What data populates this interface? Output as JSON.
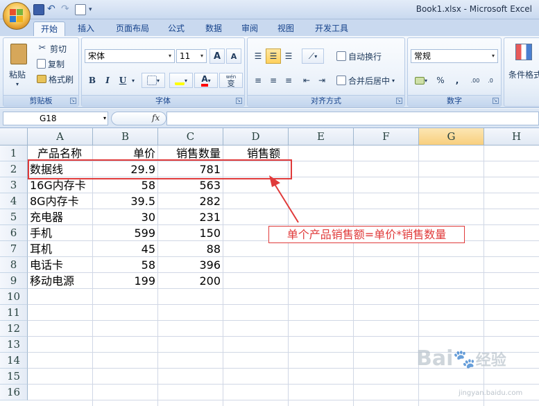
{
  "window": {
    "title": "Book1.xlsx - Microsoft Excel"
  },
  "tabs": [
    "开始",
    "插入",
    "页面布局",
    "公式",
    "数据",
    "审阅",
    "视图",
    "开发工具"
  ],
  "active_tab": "开始",
  "ribbon": {
    "clipboard": {
      "label": "剪贴板",
      "paste": "粘贴",
      "cut": "剪切",
      "copy": "复制",
      "format_painter": "格式刷"
    },
    "font": {
      "label": "字体",
      "font_name": "宋体",
      "font_size": "11",
      "bold": "B",
      "italic": "I",
      "underline": "U",
      "grow": "A",
      "shrink": "A",
      "font_color": "A",
      "wen": "wén",
      "wen_char": "变"
    },
    "alignment": {
      "label": "对齐方式",
      "wrap": "自动换行",
      "merge": "合并后居中"
    },
    "number": {
      "label": "数字",
      "format": "常规",
      "percent": "%",
      "comma": ",",
      "inc": ".00",
      "dec": ".0"
    },
    "styles": {
      "conditional": "条件格式"
    }
  },
  "formula_bar": {
    "name_box": "G18",
    "fx": "fx",
    "formula": ""
  },
  "sheet": {
    "columns": [
      "A",
      "B",
      "C",
      "D",
      "E",
      "F",
      "G",
      "H"
    ],
    "rows": [
      "1",
      "2",
      "3",
      "4",
      "5",
      "6",
      "7",
      "8",
      "9",
      "10",
      "11",
      "12",
      "13",
      "14",
      "15",
      "16"
    ],
    "header": {
      "a": "产品名称",
      "b": "单价",
      "c": "销售数量",
      "d": "销售额"
    },
    "data": [
      {
        "name": "数据线",
        "price": "29.9",
        "qty": "781"
      },
      {
        "name": "16G内存卡",
        "price": "58",
        "qty": "563"
      },
      {
        "name": "8G内存卡",
        "price": "39.5",
        "qty": "282"
      },
      {
        "name": "充电器",
        "price": "30",
        "qty": "231"
      },
      {
        "name": "手机",
        "price": "599",
        "qty": "150"
      },
      {
        "name": "耳机",
        "price": "45",
        "qty": "88"
      },
      {
        "name": "电话卡",
        "price": "58",
        "qty": "396"
      },
      {
        "name": "移动电源",
        "price": "199",
        "qty": "200"
      }
    ]
  },
  "annotation": {
    "callout": "单个产品销售额=单价*销售数量"
  },
  "watermark": {
    "brand": "Bai",
    "brand2": "经验",
    "url": "jingyan.baidu.com"
  },
  "colors": {
    "accent_red": "#e03a3a",
    "selected_col": "#f8cf7d"
  }
}
